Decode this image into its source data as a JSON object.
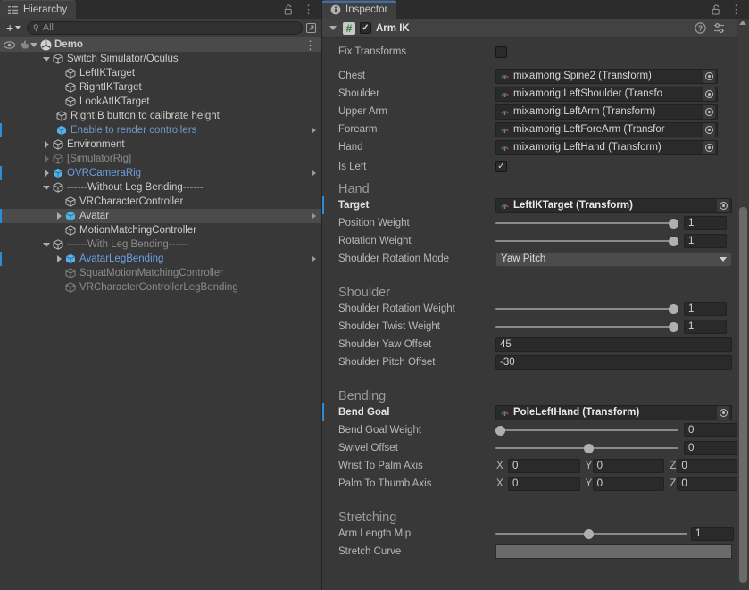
{
  "hierarchy": {
    "tab_label": "Hierarchy",
    "tab_icon": "hierarchy-icon",
    "lock_icon": "lock-open-icon",
    "menu_icon": "kebab-menu-icon",
    "toolbar": {
      "add_label": "+",
      "search_placeholder": "All",
      "search_value": "",
      "search_icon": "search-icon",
      "expand_icon": "open-in-new-icon"
    },
    "rows": [
      {
        "label": "Demo",
        "depth": 0,
        "icon": "unity-scene-icon",
        "state": "root",
        "expanded": true,
        "has_eye": true,
        "kebab": true
      },
      {
        "label": "Switch Simulator/Oculus",
        "depth": 1,
        "icon": "gameobject-icon",
        "expanded": true
      },
      {
        "label": "LeftIKTarget",
        "depth": 2,
        "icon": "gameobject-icon"
      },
      {
        "label": "RightIKTarget",
        "depth": 2,
        "icon": "gameobject-icon"
      },
      {
        "label": "LookAtIKTarget",
        "depth": 2,
        "icon": "gameobject-icon"
      },
      {
        "label": "Right B button to calibrate height",
        "depth": 2,
        "icon": "gameobject-icon"
      },
      {
        "label": "Enable to render controllers",
        "depth": 2,
        "icon": "prefab-icon",
        "style": "blue-dim",
        "override": true,
        "chevron": true
      },
      {
        "label": "Environment",
        "depth": 1,
        "icon": "gameobject-icon",
        "collapsed": true
      },
      {
        "label": "[SimulatorRig]",
        "depth": 1,
        "icon": "gameobject-icon",
        "style": "dim",
        "collapsed": true,
        "dim_tri": true
      },
      {
        "label": "OVRCameraRig",
        "depth": 1,
        "icon": "prefab-icon",
        "style": "prefab-blue",
        "collapsed": true,
        "override": true,
        "chevron": true
      },
      {
        "label": "------Without Leg Bending------",
        "depth": 1,
        "icon": "gameobject-icon",
        "expanded": true,
        "style": "dim"
      },
      {
        "label": "VRCharacterController",
        "depth": 2,
        "icon": "gameobject-icon"
      },
      {
        "label": "Avatar",
        "depth": 2,
        "icon": "prefab-icon",
        "state": "selected",
        "collapsed": true,
        "override": true,
        "chevron": true
      },
      {
        "label": "MotionMatchingController",
        "depth": 2,
        "icon": "gameobject-icon"
      },
      {
        "label": "------With Leg Bending------",
        "depth": 1,
        "icon": "gameobject-icon",
        "expanded": true,
        "style": "dim"
      },
      {
        "label": "AvatarLegBending",
        "depth": 2,
        "icon": "prefab-icon",
        "style": "prefab-blue",
        "collapsed": true,
        "override": true,
        "chevron": true
      },
      {
        "label": "SquatMotionMatchingController",
        "depth": 2,
        "icon": "gameobject-icon",
        "style": "dim"
      },
      {
        "label": "VRCharacterControllerLegBending",
        "depth": 2,
        "icon": "gameobject-icon",
        "style": "dim"
      }
    ]
  },
  "inspector": {
    "tab_label": "Inspector",
    "tab_icon": "info-icon",
    "lock_icon": "lock-open-icon",
    "menu_icon": "kebab-menu-icon",
    "component": {
      "title": "Arm IK",
      "enabled": true,
      "script_badge": "#",
      "help_icon": "help-icon",
      "preset_icon": "preset-icon",
      "menu_icon": "kebab-menu-icon"
    },
    "fields": {
      "fix_transforms": {
        "label": "Fix Transforms",
        "value": false
      },
      "chest": {
        "label": "Chest",
        "value": "mixamorig:Spine2 (Transform)"
      },
      "shoulder": {
        "label": "Shoulder",
        "value": "mixamorig:LeftShoulder (Transfo"
      },
      "upper_arm": {
        "label": "Upper Arm",
        "value": "mixamorig:LeftArm (Transform)"
      },
      "forearm": {
        "label": "Forearm",
        "value": "mixamorig:LeftForeArm (Transfor"
      },
      "hand_ref": {
        "label": "Hand",
        "value": "mixamorig:LeftHand (Transform)"
      },
      "is_left": {
        "label": "Is Left",
        "value": true
      }
    },
    "sections": {
      "hand": {
        "title": "Hand",
        "target": {
          "label": "Target",
          "value": "LeftIKTarget (Transform)"
        },
        "position_weight": {
          "label": "Position Weight",
          "value": "1",
          "fill": 1.0
        },
        "rotation_weight": {
          "label": "Rotation Weight",
          "value": "1",
          "fill": 1.0
        },
        "shoulder_rotation_mode": {
          "label": "Shoulder Rotation Mode",
          "value": "Yaw Pitch"
        }
      },
      "shoulder": {
        "title": "Shoulder",
        "rotation_weight": {
          "label": "Shoulder Rotation Weight",
          "value": "1",
          "fill": 1.0
        },
        "twist_weight": {
          "label": "Shoulder Twist Weight",
          "value": "1",
          "fill": 1.0
        },
        "yaw_offset": {
          "label": "Shoulder Yaw Offset",
          "value": "45"
        },
        "pitch_offset": {
          "label": "Shoulder Pitch Offset",
          "value": "-30"
        }
      },
      "bending": {
        "title": "Bending",
        "bend_goal": {
          "label": "Bend Goal",
          "value": "PoleLeftHand (Transform)"
        },
        "bend_goal_weight": {
          "label": "Bend Goal Weight",
          "value": "0",
          "fill": 0.0
        },
        "swivel_offset": {
          "label": "Swivel Offset",
          "value": "0",
          "fill": 0.5
        },
        "wrist_to_palm": {
          "label": "Wrist To Palm Axis",
          "x_label": "X",
          "y_label": "Y",
          "z_label": "Z",
          "x": "0",
          "y": "0",
          "z": "0"
        },
        "palm_to_thumb": {
          "label": "Palm To Thumb Axis",
          "x_label": "X",
          "y_label": "Y",
          "z_label": "Z",
          "x": "0",
          "y": "0",
          "z": "0"
        }
      },
      "stretching": {
        "title": "Stretching",
        "arm_length_mlp": {
          "label": "Arm Length Mlp",
          "value": "1",
          "fill": 0.46
        },
        "stretch_curve": {
          "label": "Stretch Curve",
          "value": ""
        }
      }
    }
  },
  "colors": {
    "accent_blue": "#2d8cd6",
    "panel_bg": "#383838",
    "tab_bg": "#3f3f3f",
    "field_bg": "#2a2a2a",
    "selected_row": "#4b4b4b",
    "link_blue": "#6e9fe0"
  }
}
